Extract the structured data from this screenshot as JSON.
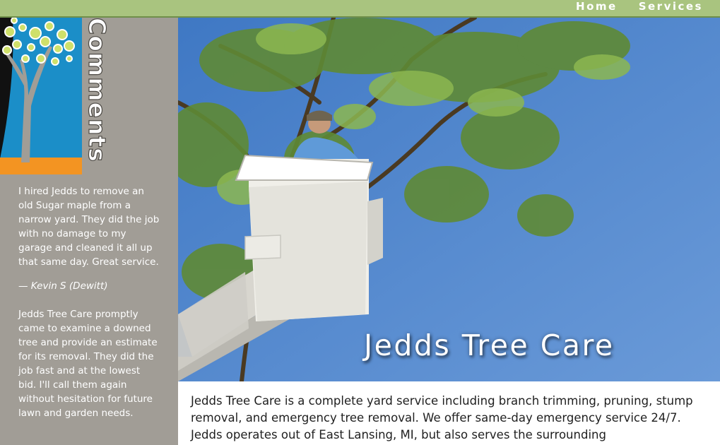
{
  "nav": {
    "home": "Home",
    "services": "Services"
  },
  "sidebar": {
    "heading": "Comments",
    "testimonials": [
      {
        "text": "I hired Jedds to remove an old Sugar maple from a narrow yard. They did the job with no damage to my garage and cleaned it all up that same day. Great service.",
        "author": "— Kevin S (Dewitt)"
      },
      {
        "text": "Jedds Tree Care promptly came to examine a downed tree and provide an estimate for its removal. They did the job fast and at the lowest bid. I'll call them again without hesitation for future lawn and garden needs.",
        "author": ""
      }
    ]
  },
  "hero": {
    "title": "Jedds Tree Care"
  },
  "main": {
    "intro": "Jedds Tree Care is a complete yard service including branch trimming, pruning, stump removal, and emergency tree removal. We offer same-day emergency service 24/7. Jedds operates out of East Lansing, MI, but also serves the surrounding"
  },
  "colors": {
    "topbar": "#a9c47f",
    "sidebar": "#a19d96",
    "sky": "#4f86cc",
    "logo_blue": "#1b8ec8",
    "logo_orange": "#f39422"
  }
}
